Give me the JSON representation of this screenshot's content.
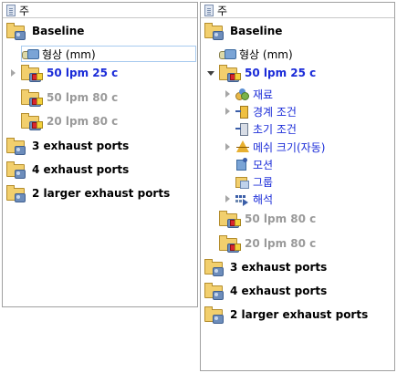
{
  "left_panel": {
    "header": "주",
    "baseline": "Baseline",
    "geometry": "형상 (mm)",
    "studies": [
      "50 lpm 25 c",
      "50 lpm 80 c",
      "20 lpm 80 c"
    ],
    "configs": [
      "3 exhaust ports",
      "4 exhaust ports",
      "2 larger exhaust ports"
    ]
  },
  "right_panel": {
    "header": "주",
    "baseline": "Baseline",
    "geometry": "형상 (mm)",
    "active_study": "50 lpm 25 c",
    "study_children": [
      "재료",
      "경계 조건",
      "초기 조건",
      "메쉬 크기(자동)",
      "모션",
      "그룹",
      "해석"
    ],
    "other_studies": [
      "50 lpm 80 c",
      "20 lpm 80 c"
    ],
    "configs": [
      "3 exhaust ports",
      "4 exhaust ports",
      "2 larger exhaust ports"
    ]
  },
  "colors": {
    "active_study": "#1a2bd8",
    "inactive_study": "#9a9a9a"
  }
}
